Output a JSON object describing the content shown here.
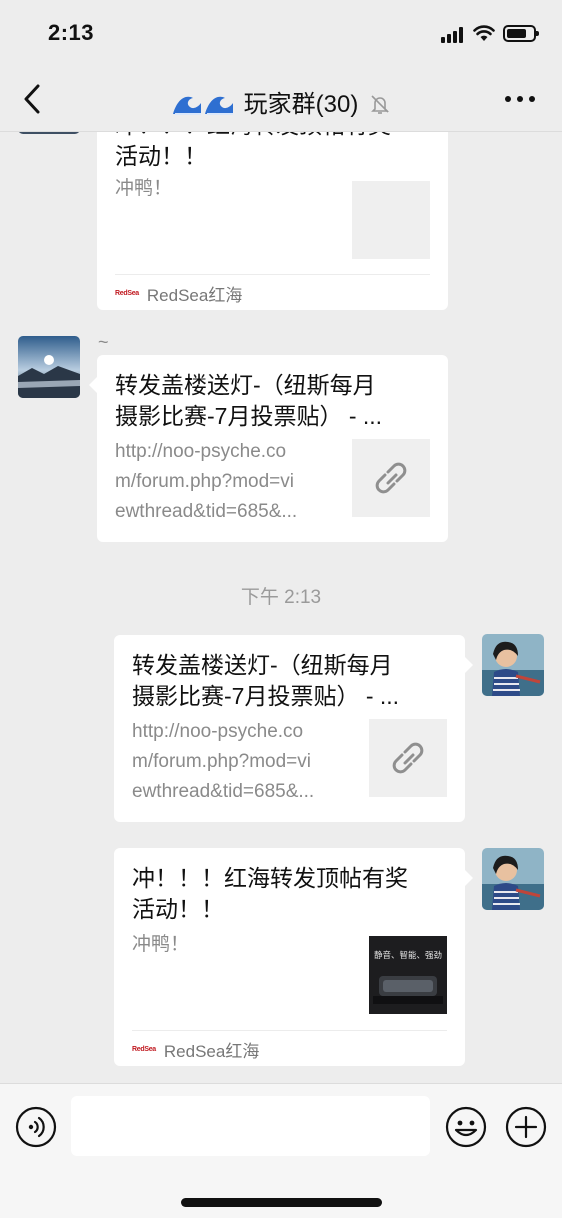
{
  "status_bar": {
    "time": "2:13"
  },
  "nav": {
    "title": "玩家群(30)"
  },
  "messages": {
    "m1": {
      "title_partial": "冲！！！红海转发顶帖有奖",
      "title_line2": "活动！！",
      "desc": "冲鸭！",
      "source": "RedSea红海",
      "source_logo": "RedSea"
    },
    "m2": {
      "sender_note": "~",
      "title": "转发盖楼送灯-（纽斯每月\n摄影比赛-7月投票贴） - ...",
      "desc": "http://noo-psyche.co\nm/forum.php?mod=vi\newthread&tid=685&..."
    },
    "timestamp": "下午 2:13",
    "m3": {
      "title": "转发盖楼送灯-（纽斯每月\n摄影比赛-7月投票贴） - ...",
      "desc": "http://noo-psyche.co\nm/forum.php?mod=vi\newthread&tid=685&..."
    },
    "m4": {
      "title": "冲！！！红海转发顶帖有奖\n活动！！",
      "desc": "冲鸭！",
      "thumb_text": "静音、智能、强劲",
      "source": "RedSea红海",
      "source_logo": "RedSea"
    }
  },
  "colors": {
    "background": "#ededed",
    "card": "#ffffff",
    "muted": "#8a8a8a"
  },
  "icons": [
    "back-icon",
    "wave-icon",
    "mute-icon",
    "more-icon",
    "link-icon",
    "voice-icon",
    "emoji-icon",
    "plus-icon"
  ]
}
